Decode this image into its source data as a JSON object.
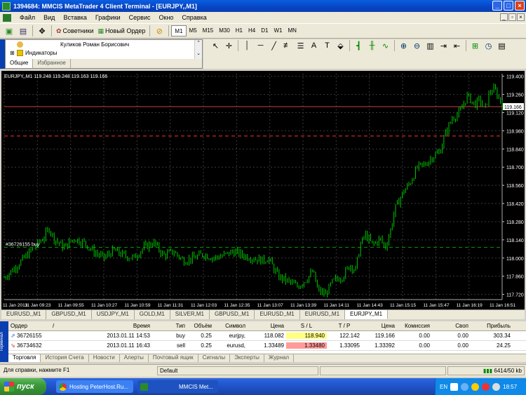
{
  "window": {
    "title": "1394684: MMCIS MetaTrader 4 Client Terminal - [EURJPY,,M1]",
    "min": "_",
    "max": "□",
    "close": "×"
  },
  "menu": [
    "Файл",
    "Вид",
    "Вставка",
    "Графики",
    "Сервис",
    "Окно",
    "Справка"
  ],
  "toolbar": {
    "advisors": "Советники",
    "new_order": "Новый Ордер",
    "timeframes": [
      "M1",
      "M5",
      "M15",
      "M30",
      "H1",
      "H4",
      "D1",
      "W1",
      "MN"
    ],
    "active_tf": "M1"
  },
  "navigator": {
    "account": "Куликов Роман Борисович",
    "indicators": "Индикаторы",
    "side_label": "Навигатор",
    "tabs": [
      "Общие",
      "Избранное"
    ]
  },
  "chart": {
    "header": "EURJPY,,M1  119.248 119.248 119.163 119.166",
    "order_label": "#36726155 buy",
    "price_label": "119.166",
    "colors": {
      "bg": "#000000",
      "candle": "#00c800",
      "grid": "#3a3a3a",
      "bid": "#c0c0c0",
      "stop": "#ff3030",
      "order": "#00a000"
    }
  },
  "chart_data": {
    "type": "line",
    "title": "EURJPY,,M1",
    "y_ticks": [
      "119.400",
      "119.260",
      "119.120",
      "118.980",
      "118.840",
      "118.700",
      "118.560",
      "118.420",
      "118.280",
      "118.140",
      "118.000",
      "117.860",
      "117.720"
    ],
    "x_ticks": [
      "11 Jan 2013",
      "11 Jan 09:23",
      "11 Jan 09:55",
      "11 Jan 10:27",
      "11 Jan 10:59",
      "11 Jan 11:31",
      "11 Jan 12:03",
      "11 Jan 12:35",
      "11 Jan 13:07",
      "11 Jan 13:39",
      "11 Jan 14:11",
      "11 Jan 14:43",
      "11 Jan 15:15",
      "11 Jan 15:47",
      "11 Jan 16:19",
      "11 Jan 16:51"
    ],
    "ylim": [
      117.68,
      119.42
    ],
    "order_price": 118.082,
    "stop_price": 118.94,
    "bid": 119.166,
    "close_path": [
      [
        0,
        117.85
      ],
      [
        0.02,
        117.92
      ],
      [
        0.04,
        118.0
      ],
      [
        0.06,
        118.08
      ],
      [
        0.08,
        118.16
      ],
      [
        0.09,
        118.23
      ],
      [
        0.1,
        118.15
      ],
      [
        0.12,
        118.08
      ],
      [
        0.14,
        118.15
      ],
      [
        0.16,
        118.12
      ],
      [
        0.18,
        118.05
      ],
      [
        0.2,
        118.0
      ],
      [
        0.22,
        118.06
      ],
      [
        0.24,
        118.02
      ],
      [
        0.26,
        118.0
      ],
      [
        0.28,
        118.08
      ],
      [
        0.3,
        118.12
      ],
      [
        0.32,
        118.02
      ],
      [
        0.34,
        118.05
      ],
      [
        0.36,
        117.98
      ],
      [
        0.38,
        118.0
      ],
      [
        0.4,
        118.03
      ],
      [
        0.42,
        118.0
      ],
      [
        0.44,
        118.02
      ],
      [
        0.46,
        118.05
      ],
      [
        0.48,
        118.02
      ],
      [
        0.5,
        118.0
      ],
      [
        0.52,
        117.98
      ],
      [
        0.53,
        118.0
      ],
      [
        0.55,
        117.86
      ],
      [
        0.57,
        117.82
      ],
      [
        0.59,
        117.78
      ],
      [
        0.61,
        117.85
      ],
      [
        0.62,
        117.9
      ],
      [
        0.63,
        117.75
      ],
      [
        0.645,
        117.72
      ],
      [
        0.66,
        117.82
      ],
      [
        0.68,
        117.86
      ],
      [
        0.695,
        117.95
      ],
      [
        0.705,
        117.9
      ],
      [
        0.715,
        118.1
      ],
      [
        0.725,
        118.18
      ],
      [
        0.74,
        118.1
      ],
      [
        0.755,
        118.15
      ],
      [
        0.765,
        118.08
      ],
      [
        0.775,
        118.2
      ],
      [
        0.785,
        118.38
      ],
      [
        0.8,
        118.5
      ],
      [
        0.815,
        118.58
      ],
      [
        0.83,
        118.7
      ],
      [
        0.845,
        118.72
      ],
      [
        0.86,
        118.78
      ],
      [
        0.875,
        118.82
      ],
      [
        0.885,
        118.95
      ],
      [
        0.9,
        119.08
      ],
      [
        0.915,
        119.12
      ],
      [
        0.93,
        119.25
      ],
      [
        0.945,
        119.18
      ],
      [
        0.955,
        119.22
      ],
      [
        0.965,
        119.14
      ],
      [
        0.975,
        119.28
      ],
      [
        0.985,
        119.3
      ],
      [
        1.0,
        119.18
      ]
    ]
  },
  "chart_tabs": [
    "EURUSD,,M1",
    "GBPUSD,,M1",
    "USDJPY,,M1",
    "GOLD,M1",
    "SILVER,M1",
    "GBPUSD,,M1",
    "EURUSD,,M1",
    "EURUSD,,M1",
    "EURJPY,,M1"
  ],
  "active_chart_tab": "EURJPY,,M1",
  "terminal": {
    "side_label": "Терминал",
    "columns": [
      "Ордер",
      "/",
      "Время",
      "Тип",
      "Объём",
      "Символ",
      "Цена",
      "S / L",
      "T / P",
      "Цена",
      "Комиссия",
      "Своп",
      "Прибыль"
    ],
    "rows": [
      [
        "36726155",
        "2013.01.11 14:53",
        "buy",
        "0.25",
        "eurjpy,",
        "118.082",
        "118.940",
        "122.142",
        "119.166",
        "0.00",
        "0.00",
        "303.34"
      ],
      [
        "36734632",
        "2013.01.11 16:43",
        "sell",
        "0.25",
        "eurusd,",
        "1.33489",
        "1.33480",
        "1.33095",
        "1.33392",
        "0.00",
        "0.00",
        "24.25"
      ]
    ],
    "tabs": [
      "Торговля",
      "История Счета",
      "Новости",
      "Алерты",
      "Почтовый ящик",
      "Сигналы",
      "Эксперты",
      "Журнал"
    ]
  },
  "status": {
    "help": "Для справки, нажмите F1",
    "profile": "Default",
    "traffic": "6414/50 kb"
  },
  "taskbar": {
    "start": "пуск",
    "tasks": [
      "Hosting PeterHost.Ru...",
      "MMCIS Met..."
    ],
    "lang": "EN",
    "time": "18:57"
  }
}
